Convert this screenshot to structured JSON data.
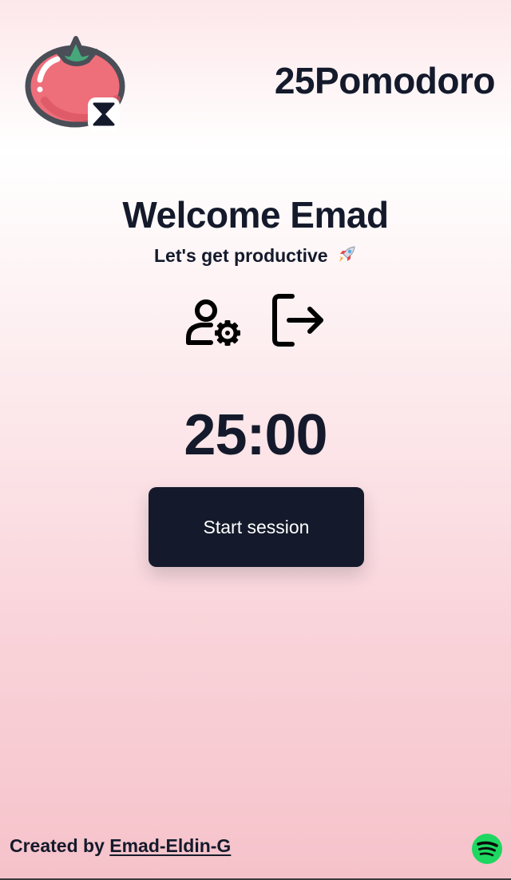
{
  "header": {
    "app_title": "25Pomodoro",
    "logo_icon": "tomato-hourglass-icon"
  },
  "main": {
    "welcome_text": "Welcome Emad",
    "subtitle_text": "Let's get productive",
    "subtitle_icon": "rocket-icon",
    "actions": [
      {
        "icon": "user-settings-icon"
      },
      {
        "icon": "logout-icon"
      }
    ],
    "timer": "25:00",
    "start_button_label": "Start session"
  },
  "footer": {
    "created_by": "Created by",
    "author_link": "Emad-Eldin-G",
    "spotify_icon": "spotify-icon"
  },
  "colors": {
    "primary_dark": "#141a2b",
    "tomato": "#ee6e7a",
    "spotify_green": "#1ed760",
    "background_top": "#ffffff",
    "background_bottom": "#f6c2ca"
  }
}
